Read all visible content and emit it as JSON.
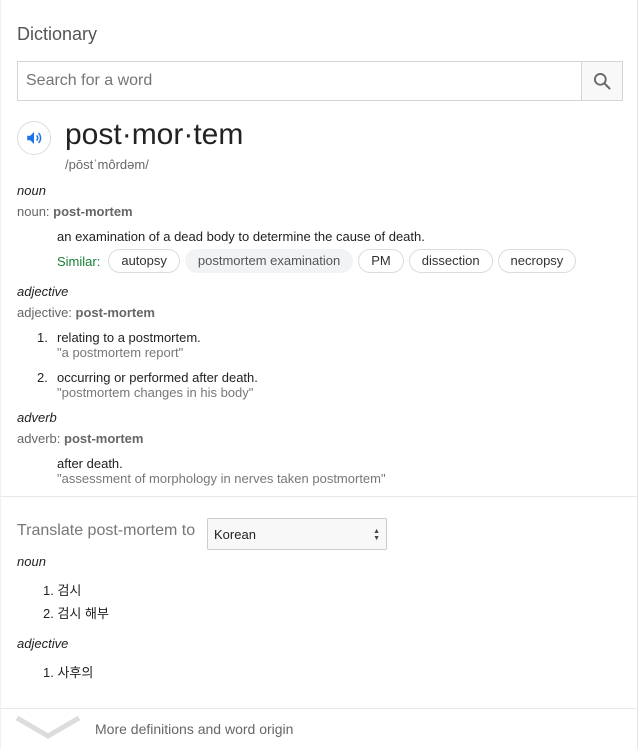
{
  "app": {
    "title": "Dictionary"
  },
  "search": {
    "placeholder": "Search for a word",
    "value": ""
  },
  "entry": {
    "word": "post·mor·tem",
    "phonetic": "/pōstˈmôrdəm/",
    "noun": {
      "pos": "noun",
      "line_prefix": "noun:",
      "form": "post-mortem",
      "definition": "an examination of a dead body to determine the cause of death.",
      "similar_label": "Similar:",
      "similar": [
        "autopsy",
        "postmortem examination",
        "PM",
        "dissection",
        "necropsy"
      ]
    },
    "adjective": {
      "pos": "adjective",
      "line_prefix": "adjective:",
      "form": "post-mortem",
      "senses": [
        {
          "num": "1.",
          "definition": "relating to a postmortem.",
          "example": "\"a postmortem report\""
        },
        {
          "num": "2.",
          "definition": "occurring or performed after death.",
          "example": "\"postmortem changes in his body\""
        }
      ]
    },
    "adverb": {
      "pos": "adverb",
      "line_prefix": "adverb:",
      "form": "post-mortem",
      "definition": "after death.",
      "example": "\"assessment of morphology in nerves taken postmortem\""
    }
  },
  "translate": {
    "label": "Translate post-mortem to",
    "language": "Korean",
    "noun_label": "noun",
    "noun_items": [
      "1. 검시",
      "2. 검시 해부"
    ],
    "adjective_label": "adjective",
    "adjective_items": [
      "1. 사후의"
    ]
  },
  "footer": {
    "more_label": "More definitions and word origin"
  },
  "colors": {
    "similar_label": "#188038",
    "speaker_icon": "#1a73e8"
  },
  "icons": {
    "search": "search-icon",
    "speaker": "speaker-icon",
    "expand": "chevron-down-icon"
  }
}
